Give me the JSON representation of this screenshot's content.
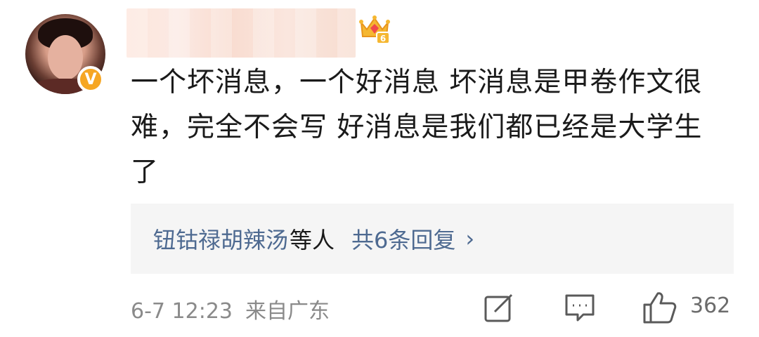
{
  "comment": {
    "verified_mark": "V",
    "level_badge": "6",
    "text": "一个坏消息，一个好消息 坏消息是甲卷作文很难，完全不会写 好消息是我们都已经是大学生了",
    "replies": {
      "names": "钮钴禄胡辣汤",
      "suffix": "等人",
      "count": "共6条回复",
      "chevron": "›"
    },
    "timestamp": "6-7 12:23",
    "location": "来自广东",
    "like_count": "362",
    "icons": {
      "share": "share-edit-icon",
      "comment": "comment-icon",
      "like": "thumbs-up-icon",
      "crown": "crown-badge-icon"
    },
    "colors": {
      "link": "#4e6a91",
      "badge": "#f6a623",
      "meta": "#8a8a8a"
    }
  }
}
